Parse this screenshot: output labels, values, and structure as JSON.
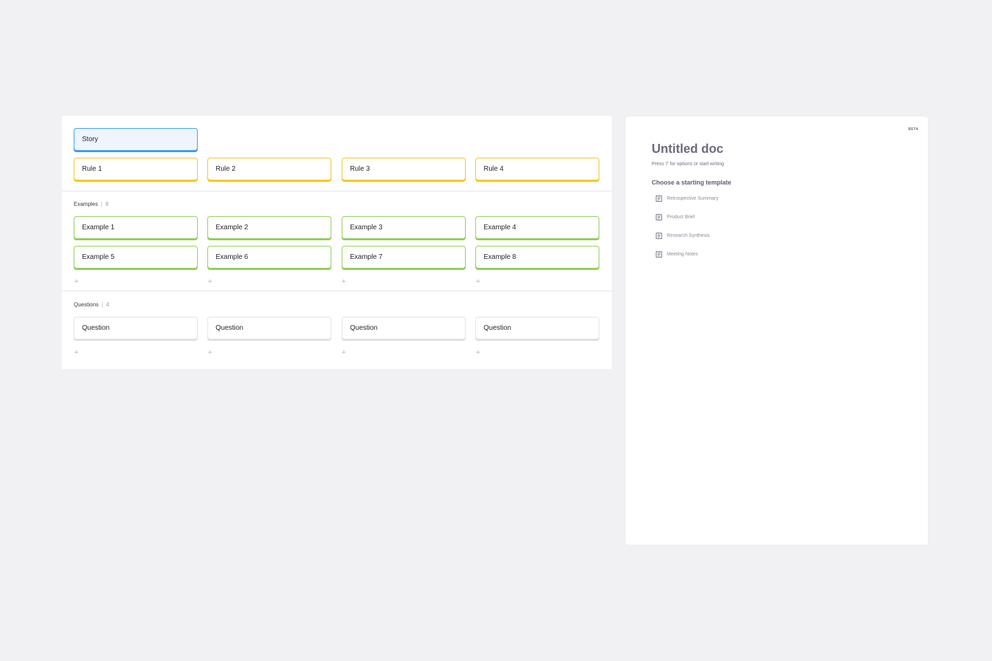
{
  "board": {
    "story": {
      "label": "Story"
    },
    "rules": [
      {
        "label": "Rule 1"
      },
      {
        "label": "Rule 2"
      },
      {
        "label": "Rule 3"
      },
      {
        "label": "Rule 4"
      }
    ],
    "examples_section": {
      "label": "Examples",
      "count": "8",
      "cards": [
        {
          "label": "Example 1"
        },
        {
          "label": "Example 2"
        },
        {
          "label": "Example 3"
        },
        {
          "label": "Example 4"
        },
        {
          "label": "Example 5"
        },
        {
          "label": "Example 6"
        },
        {
          "label": "Example 7"
        },
        {
          "label": "Example 8"
        }
      ],
      "add_symbol": "+"
    },
    "questions_section": {
      "label": "Questions",
      "count": "4",
      "cards": [
        {
          "label": "Question"
        },
        {
          "label": "Question"
        },
        {
          "label": "Question"
        },
        {
          "label": "Question"
        }
      ],
      "add_symbol": "+"
    }
  },
  "doc": {
    "badge": "BETA",
    "title": "Untitled doc",
    "hint": "Press '/' for options or start writing",
    "template_heading": "Choose a starting template",
    "templates": [
      {
        "label": "Retrospective Summary",
        "icon": "document-icon"
      },
      {
        "label": "Product Brief",
        "icon": "document-icon"
      },
      {
        "label": "Research Synthesis",
        "icon": "document-icon"
      },
      {
        "label": "Meeting Notes",
        "icon": "document-icon"
      }
    ]
  },
  "colors": {
    "story": "#3d9bec",
    "rule": "#f3c623",
    "example": "#8fcf58",
    "question": "#dcdce1",
    "background": "#f1f1f3"
  }
}
